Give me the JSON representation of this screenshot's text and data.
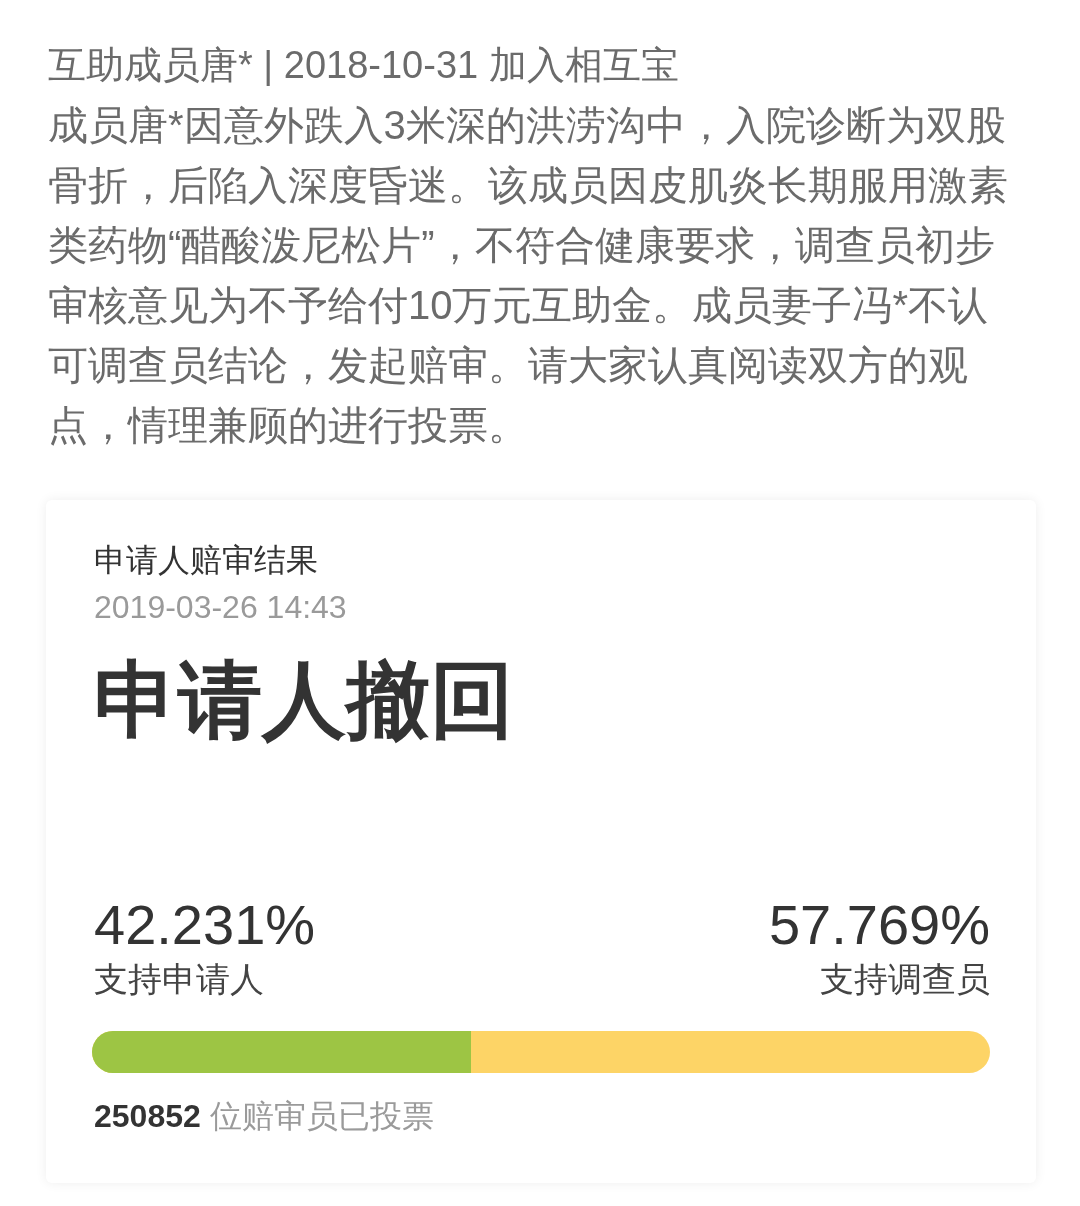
{
  "member_header": "互助成员唐* | 2018-10-31 加入相互宝",
  "description": "成员唐*因意外跌入3米深的洪涝沟中，入院诊断为双股骨折，后陷入深度昏迷。该成员因皮肌炎长期服用激素类药物“醋酸泼尼松片”，不符合健康要求，调查员初步审核意见为不予给付10万元互助金。成员妻子冯*不认可调查员结论，发起赔审。请大家认真阅读双方的观点，情理兼顾的进行投票。",
  "result_card": {
    "title": "申请人赔审结果",
    "time": "2019-03-26 14:43",
    "verdict": "申请人撤回",
    "sides": [
      {
        "percent": "42.231%",
        "label": "支持申请人",
        "color": "#9dc544"
      },
      {
        "percent": "57.769%",
        "label": "支持调查员",
        "color": "#fdd466"
      }
    ],
    "bar": {
      "level": 0.42231
    },
    "votes": "**250852** 位赔审员已投票"
  }
}
